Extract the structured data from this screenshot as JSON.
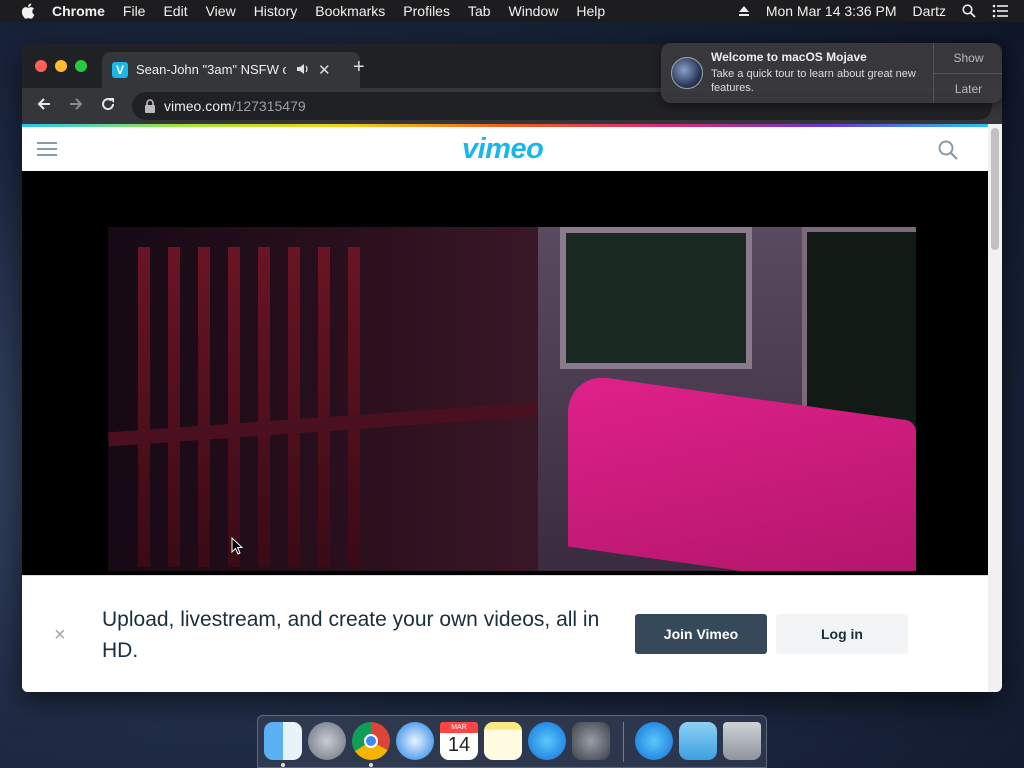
{
  "menubar": {
    "app_name": "Chrome",
    "items": [
      "File",
      "Edit",
      "View",
      "History",
      "Bookmarks",
      "Profiles",
      "Tab",
      "Window",
      "Help"
    ],
    "datetime": "Mon Mar 14  3:36 PM",
    "user": "Dartz"
  },
  "notification": {
    "title": "Welcome to macOS Mojave",
    "body": "Take a quick tour to learn about great new features.",
    "show_label": "Show",
    "later_label": "Later"
  },
  "browser": {
    "tab_title": "Sean-John \"3am\" NSFW o",
    "tab_favicon": "V",
    "url_host": "vimeo.com",
    "url_path": "/127315479"
  },
  "site": {
    "logo": "vimeo",
    "banner_text": "Upload, livestream, and create your own videos, all in HD.",
    "join_label": "Join Vimeo",
    "login_label": "Log in",
    "dismiss_label": "×"
  },
  "dock": {
    "calendar_month": "MAR",
    "calendar_day": "14"
  },
  "colors": {
    "vimeo_blue": "#1ab7ea",
    "join_button": "#35495a"
  }
}
